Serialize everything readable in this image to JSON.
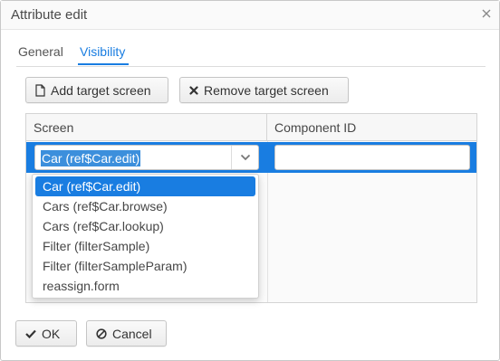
{
  "window": {
    "title": "Attribute edit"
  },
  "tabs": [
    {
      "label": "General"
    },
    {
      "label": "Visibility"
    }
  ],
  "toolbar": {
    "add_label": "Add target screen",
    "remove_label": "Remove target screen"
  },
  "table": {
    "columns": [
      "Screen",
      "Component ID"
    ],
    "row": {
      "screen_value": "Car (ref$Car.edit)",
      "component_id": ""
    }
  },
  "dropdown": {
    "options": [
      "Car (ref$Car.edit)",
      "Cars (ref$Car.browse)",
      "Cars (ref$Car.lookup)",
      "Filter (filterSample)",
      "Filter (filterSampleParam)",
      "reassign.form"
    ],
    "selected_index": 0
  },
  "footer": {
    "ok_label": "OK",
    "cancel_label": "Cancel"
  },
  "colors": {
    "accent": "#197de1",
    "text": "#464646"
  },
  "icons": {
    "close": "close-icon",
    "add": "document-icon",
    "remove": "x-icon",
    "ok": "check-icon",
    "cancel": "ban-icon",
    "combo": "chevron-down-icon"
  }
}
